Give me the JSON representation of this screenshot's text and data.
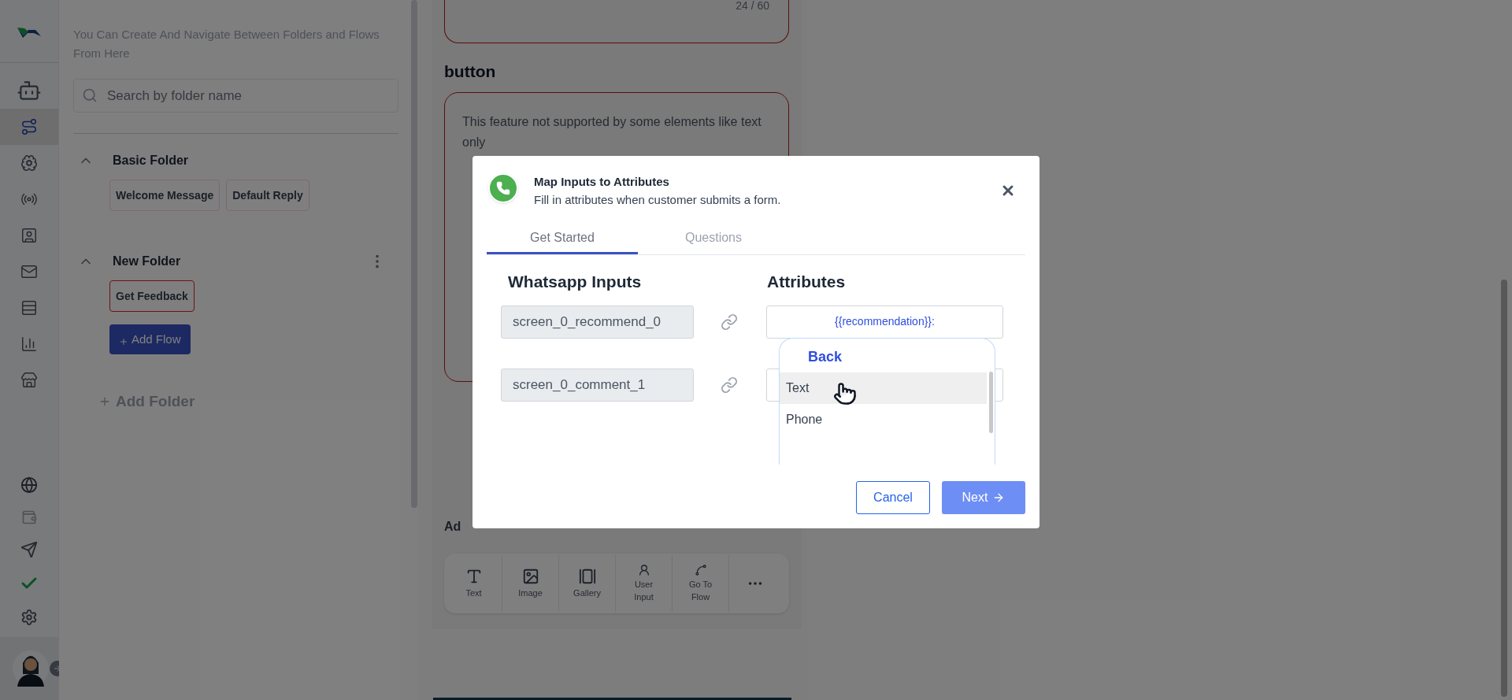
{
  "rail": {
    "items": [
      {
        "selected": false
      },
      {
        "selected": true
      },
      {
        "selected": false
      },
      {
        "selected": false
      },
      {
        "selected": false
      },
      {
        "selected": false
      },
      {
        "selected": false
      },
      {
        "selected": false
      },
      {
        "selected": false
      }
    ]
  },
  "folder_panel": {
    "description": "You Can Create And Navigate Between Folders and Flows From Here",
    "search": {
      "placeholder": "Search by folder name"
    },
    "folders": [
      {
        "name": "Basic Folder",
        "expanded": true,
        "has_menu": false,
        "flows": [
          {
            "name": "Welcome Message",
            "selected": false
          },
          {
            "name": "Default Reply",
            "selected": false
          }
        ]
      },
      {
        "name": "New Folder",
        "expanded": true,
        "has_menu": true,
        "flows": [
          {
            "name": "Get Feedback",
            "selected": true
          }
        ],
        "add_flow": "Add Flow"
      }
    ],
    "add_folder": "Add Folder"
  },
  "editor": {
    "char_count": "24 / 60",
    "section_title": "button",
    "notice": "This feature not supported by some elements like text only",
    "add_label": "Ad",
    "toolbar": [
      {
        "label": "Text"
      },
      {
        "label": "Image"
      },
      {
        "label": "Gallery"
      },
      {
        "label": "User Input"
      },
      {
        "label": "Go To Flow"
      }
    ]
  },
  "modal": {
    "title": "Map Inputs to Attributes",
    "subtitle": "Fill in attributes when customer submits a form.",
    "tabs": [
      {
        "label": "Get Started",
        "selected": true
      },
      {
        "label": "Questions",
        "selected": false
      }
    ],
    "columns": [
      "Whatsapp Inputs",
      "Attributes"
    ],
    "rows": [
      {
        "input": "screen_0_recommend_0",
        "attribute": "{{recommendation}}:"
      },
      {
        "input": "screen_0_comment_1"
      }
    ],
    "dropdown": {
      "back": "Back",
      "options": [
        {
          "label": "Text",
          "selected": true
        },
        {
          "label": "Phone",
          "selected": false
        }
      ]
    },
    "buttons": {
      "cancel": "Cancel",
      "next": "Next"
    }
  }
}
